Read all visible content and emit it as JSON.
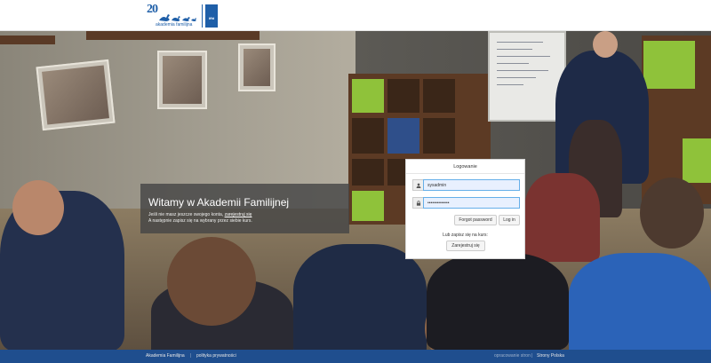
{
  "header": {
    "logo": {
      "number": "20",
      "org_name": "akademia familijna",
      "partner": "iffd"
    }
  },
  "welcome": {
    "title": "Witamy w Akademii Familijnej",
    "line1_before": "Jeśli nie masz jeszcze swojego konta, ",
    "line1_link": "zarejestruj się",
    "line2": "A następnie zapisz się na wybrany przez siebie kurs."
  },
  "login": {
    "title": "Logowanie",
    "username_value": "sysadmin",
    "password_value": "••••••••••••••",
    "forgot_label": "Forgot password",
    "login_label": "Log in",
    "signup_text": "Lub zapisz się na kurs:",
    "signup_button": "Zarejestruj się"
  },
  "footer": {
    "left_links": [
      "Akademia Familijna",
      "polityka prywatności"
    ],
    "right_links": [
      "opracowanie stron",
      "Strony Polska"
    ]
  },
  "colors": {
    "footer_bg": "#1f4e8e",
    "brand_blue": "#1f5fa8",
    "accent_green": "#8fc23a",
    "input_focus": "#66afe9"
  }
}
